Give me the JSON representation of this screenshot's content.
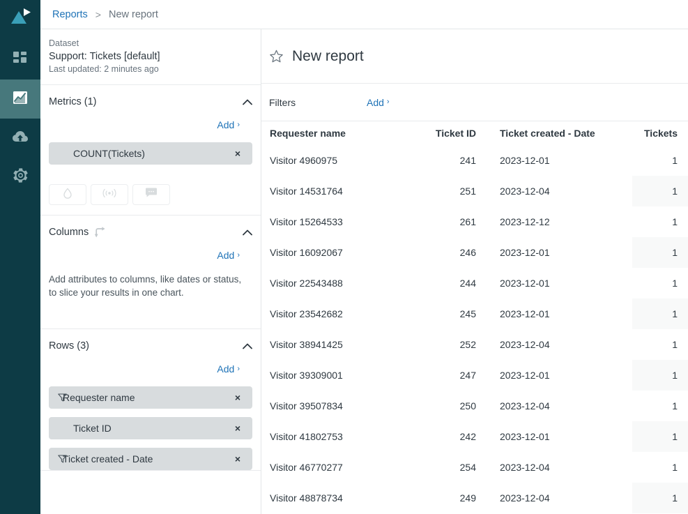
{
  "rail": {
    "logo_name": "product-logo",
    "items": [
      {
        "icon": "dashboard-grid-icon",
        "name": "sidebar-item-dashboard",
        "active": false
      },
      {
        "icon": "chart-report-icon",
        "name": "sidebar-item-reports",
        "active": true
      },
      {
        "icon": "cloud-upload-icon",
        "name": "sidebar-item-uploads",
        "active": false
      },
      {
        "icon": "gear-icon",
        "name": "sidebar-item-settings",
        "active": false
      }
    ]
  },
  "breadcrumb": {
    "parent": "Reports",
    "separator": ">",
    "current": "New report"
  },
  "dataset": {
    "label": "Dataset",
    "name": "Support: Tickets [default]",
    "updated": "Last updated: 2 minutes ago"
  },
  "metrics": {
    "title": "Metrics (1)",
    "add_label": "Add",
    "add_caret": "›",
    "collapse_icon": "chevron-up-icon",
    "chips": [
      {
        "label": "COUNT(Tickets)",
        "has_filter": false,
        "remove": "×"
      }
    ],
    "tools": [
      {
        "icon": "droplet-icon",
        "name": "metric-tool-color"
      },
      {
        "icon": "broadcast-icon",
        "name": "metric-tool-alert"
      },
      {
        "icon": "comment-icon",
        "name": "metric-tool-comment"
      }
    ]
  },
  "columns": {
    "title": "Columns",
    "swap_icon": "transpose-arrow-icon",
    "add_label": "Add",
    "add_caret": "›",
    "collapse_icon": "chevron-up-icon",
    "hint": "Add attributes to columns, like dates or status, to slice your results in one chart."
  },
  "rows": {
    "title": "Rows (3)",
    "add_label": "Add",
    "add_caret": "›",
    "collapse_icon": "chevron-up-icon",
    "chips": [
      {
        "label": "Requester name",
        "has_filter": true,
        "remove": "×"
      },
      {
        "label": "Ticket ID",
        "has_filter": false,
        "remove": "×"
      },
      {
        "label": "Ticket created - Date",
        "has_filter": true,
        "remove": "×"
      }
    ]
  },
  "report": {
    "star_icon": "star-outline-icon",
    "title": "New report",
    "filters_label": "Filters",
    "filters_add_label": "Add",
    "filters_add_caret": "›"
  },
  "table": {
    "headers": [
      "Requester name",
      "Ticket ID",
      "Ticket created - Date",
      "Tickets"
    ],
    "rows": [
      [
        "Visitor 4960975",
        "241",
        "2023-12-01",
        "1"
      ],
      [
        "Visitor 14531764",
        "251",
        "2023-12-04",
        "1"
      ],
      [
        "Visitor 15264533",
        "261",
        "2023-12-12",
        "1"
      ],
      [
        "Visitor 16092067",
        "246",
        "2023-12-01",
        "1"
      ],
      [
        "Visitor 22543488",
        "244",
        "2023-12-01",
        "1"
      ],
      [
        "Visitor 23542682",
        "245",
        "2023-12-01",
        "1"
      ],
      [
        "Visitor 38941425",
        "252",
        "2023-12-04",
        "1"
      ],
      [
        "Visitor 39309001",
        "247",
        "2023-12-01",
        "1"
      ],
      [
        "Visitor 39507834",
        "250",
        "2023-12-04",
        "1"
      ],
      [
        "Visitor 41802753",
        "242",
        "2023-12-01",
        "1"
      ],
      [
        "Visitor 46770277",
        "254",
        "2023-12-04",
        "1"
      ],
      [
        "Visitor 48878734",
        "249",
        "2023-12-04",
        "1"
      ]
    ]
  },
  "colors": {
    "rail_bg": "#0d3b45",
    "rail_active": "#47787c",
    "logo_teal": "#37a4bd",
    "link_blue": "#1f73b7",
    "text_dark": "#2f3941",
    "text_muted": "#68737d",
    "chip_bg": "#d8dcde",
    "alt_cell": "#f8f9f9"
  }
}
